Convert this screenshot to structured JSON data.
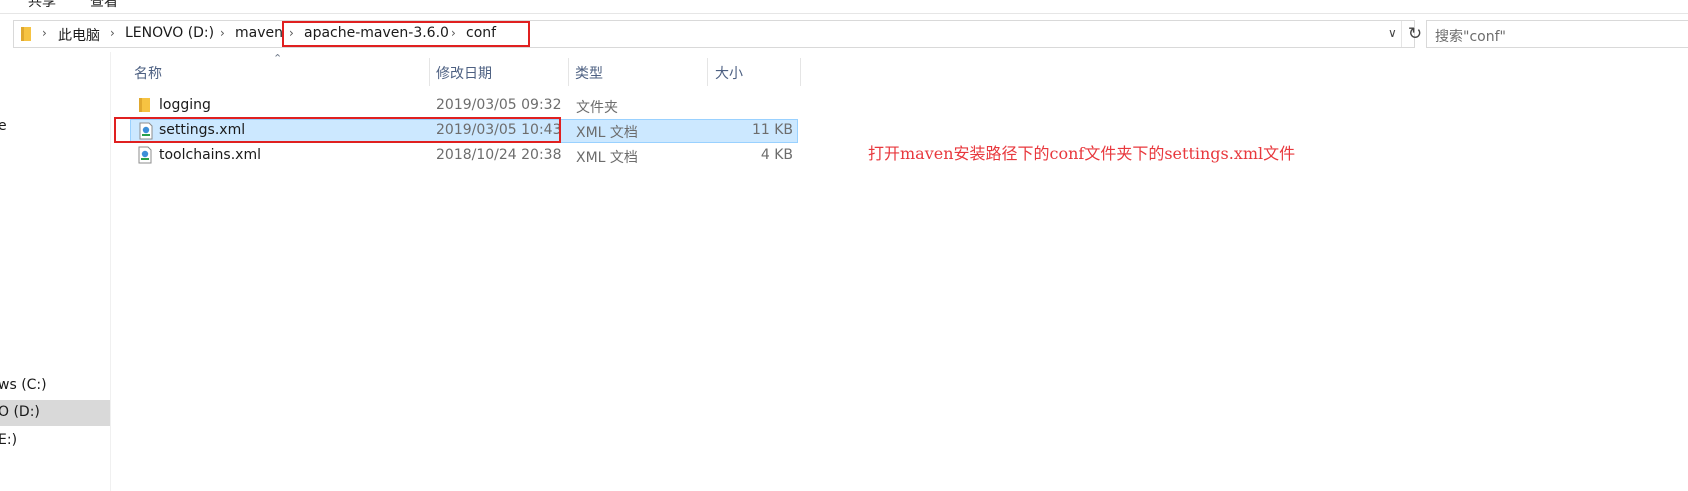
{
  "ribbon": {
    "tabs": [
      "共享",
      "查看"
    ]
  },
  "address": {
    "breadcrumbs": [
      "此电脑",
      "LENOVO (D:)",
      "maven",
      "apache-maven-3.6.0",
      "conf"
    ]
  },
  "search": {
    "placeholder": "搜索\"conf\""
  },
  "sidebar": {
    "items": [
      {
        "label": "e"
      },
      {
        "label": "ws (C:)"
      },
      {
        "label": "O (D:)"
      },
      {
        "label": "E:)"
      }
    ]
  },
  "filelist": {
    "columns": [
      "名称",
      "修改日期",
      "类型",
      "大小"
    ],
    "rows": [
      {
        "name": "logging",
        "modified": "2019/03/05 09:32",
        "type": "文件夹",
        "size": "",
        "icon": "folder-icon"
      },
      {
        "name": "settings.xml",
        "modified": "2019/03/05 10:43",
        "type": "XML 文档",
        "size": "11 KB",
        "icon": "xml-file-icon",
        "selected": true
      },
      {
        "name": "toolchains.xml",
        "modified": "2018/10/24 20:38",
        "type": "XML 文档",
        "size": "4 KB",
        "icon": "xml-file-icon"
      }
    ]
  },
  "annotation": {
    "text": "打开maven安装路径下的conf文件夹下的settings.xml文件"
  },
  "colors": {
    "highlight_box": "#e02020",
    "annotation": "#e8383d",
    "selection": "#cce8ff"
  }
}
